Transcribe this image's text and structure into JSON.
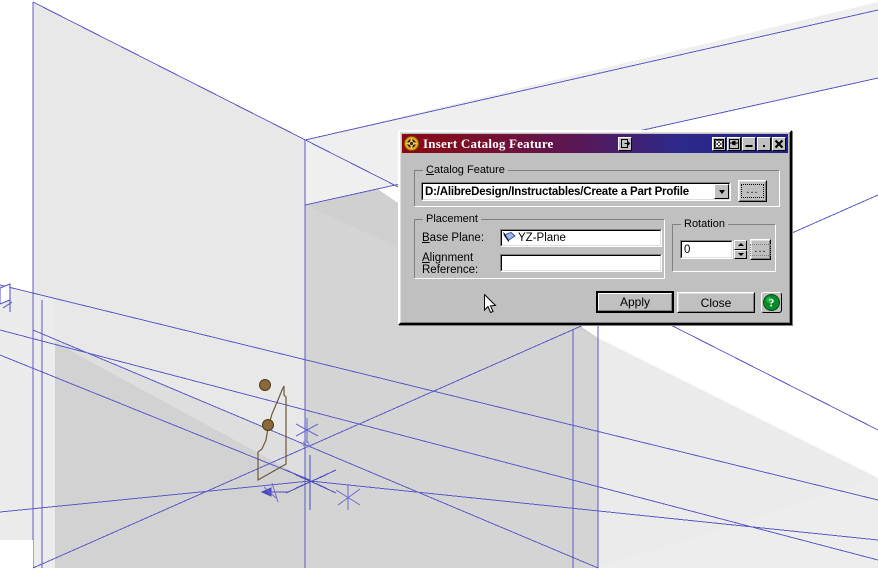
{
  "window": {
    "title": "Insert Catalog Feature",
    "app_icon": "alibre-logo-icon",
    "titlebar_buttons": [
      {
        "name": "detach-button",
        "glyph": "❐"
      },
      {
        "name": "pattern-button",
        "glyph": "☒"
      },
      {
        "name": "pin-button",
        "glyph": "⚑"
      },
      {
        "name": "minimize-button",
        "glyph": "–"
      },
      {
        "name": "restore-button",
        "glyph": "·"
      },
      {
        "name": "close-button",
        "glyph": "✕"
      }
    ]
  },
  "catalog_feature": {
    "group_label": "Catalog Feature",
    "group_label_accel": "C",
    "path_value": "D:/AlibreDesign/Instructables/Create a Part Profile",
    "browse_label": "...",
    "dropdown_glyph": "▾"
  },
  "placement": {
    "group_label": "Placement",
    "base_plane_label": "Base Plane:",
    "base_plane_accel": "B",
    "base_plane_value": "YZ-Plane",
    "base_plane_icon": "plane-icon",
    "alignment_label_line1": "Alignment",
    "alignment_label_line2": "Reference:",
    "alignment_accel": "A",
    "alignment_value": ""
  },
  "rotation": {
    "group_label": "Rotation",
    "value": "0",
    "more_label": "...",
    "up_glyph": "▴",
    "down_glyph": "▾"
  },
  "actions": {
    "apply_label": "Apply",
    "close_label": "Close",
    "help_label": "?"
  },
  "colors": {
    "dialog_face": "#c0c0c0",
    "title_left": "#8a0a12",
    "title_right": "#202080",
    "plane_line": "#5b5bc8",
    "plane_fill_light": "#ebebeb",
    "plane_fill_mid": "#dcdcdc",
    "plane_fill_dark": "#cfcfcf",
    "sketch_stroke": "#6b5a3a",
    "sketch_point": "#8a6a3a",
    "help_green": "#0a8a2a",
    "viewport_bg": "#ffffff"
  },
  "scene": {
    "name": "3d-modeling-viewport",
    "description": "Three reference planes shown in isometric view with a sketch profile",
    "sketch_points": 2
  }
}
